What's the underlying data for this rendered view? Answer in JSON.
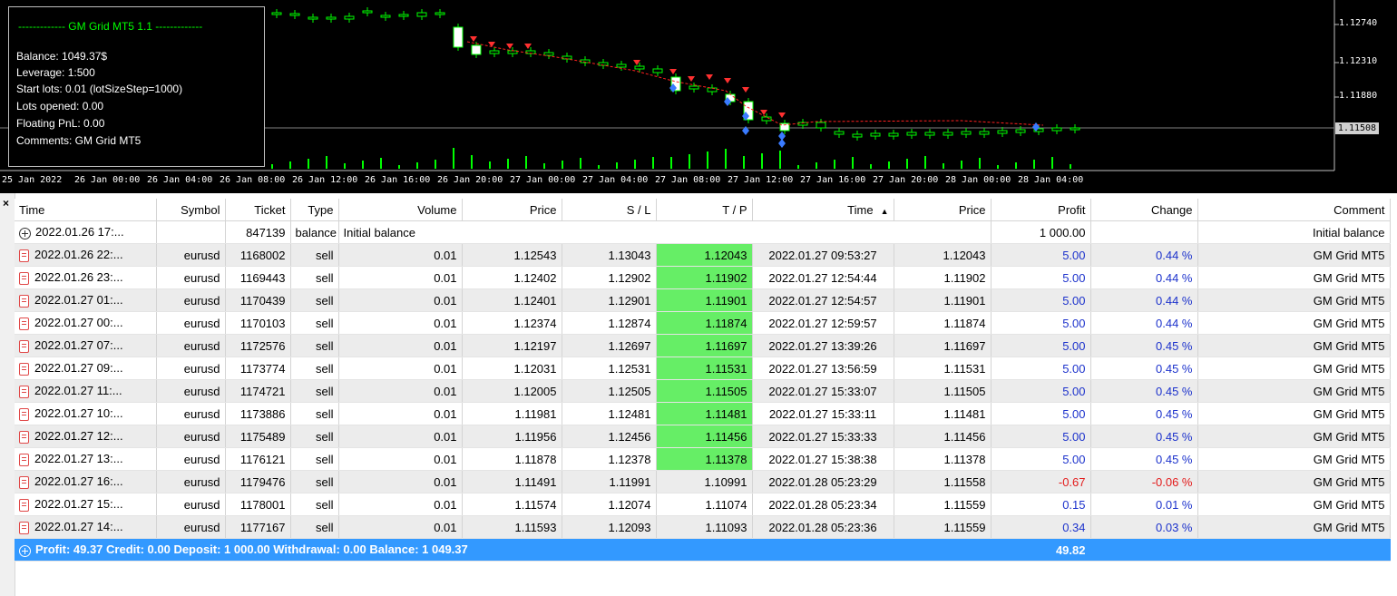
{
  "chart": {
    "price_labels": [
      "1.12740",
      "1.12310",
      "1.11880"
    ],
    "current_price": "1.11508",
    "time_labels": [
      "25 Jan 2022",
      "26 Jan 00:00",
      "26 Jan 04:00",
      "26 Jan 08:00",
      "26 Jan 12:00",
      "26 Jan 16:00",
      "26 Jan 20:00",
      "27 Jan 00:00",
      "27 Jan 04:00",
      "27 Jan 08:00",
      "27 Jan 12:00",
      "27 Jan 16:00",
      "27 Jan 20:00",
      "28 Jan 00:00",
      "28 Jan 04:00"
    ],
    "info": {
      "title": "------------- GM Grid MT5 1.1 -------------",
      "lines": [
        "Balance:  1049.37$",
        "Leverage:   1:500",
        "Start lots:     0.01 (lotSizeStep=1000)",
        "Lots opened:   0.00",
        "Floating PnL:   0.00",
        "Comments:  GM Grid MT5"
      ]
    },
    "colors": {
      "bull": "#00ff00",
      "grid": "#808080",
      "arrow_sell": "#ff3030",
      "arrow_buy": "#3a7bff",
      "trend": "#ff2020"
    }
  },
  "close_symbol": "×",
  "table": {
    "headers": [
      "Time",
      "Symbol",
      "Ticket",
      "Type",
      "Volume",
      "Price",
      "S / L",
      "T / P",
      "Time",
      "Price",
      "Profit",
      "Change",
      "Comment"
    ],
    "sort_indicator": "▲",
    "balance_row": {
      "time": "2022.01.26 17:...",
      "ticket": "847139",
      "type": "balance",
      "volume": "Initial balance",
      "profit": "1 000.00",
      "comment": "Initial balance"
    },
    "rows": [
      {
        "time": "2022.01.26 22:...",
        "symbol": "eurusd",
        "ticket": "1168002",
        "type": "sell",
        "volume": "0.01",
        "price": "1.12543",
        "sl": "1.13043",
        "tp": "1.12043",
        "tp_hit": true,
        "ctime": "2022.01.27 09:53:27",
        "cprice": "1.12043",
        "profit": "5.00",
        "change": "0.44 %",
        "neg": false,
        "comment": "GM Grid MT5"
      },
      {
        "time": "2022.01.26 23:...",
        "symbol": "eurusd",
        "ticket": "1169443",
        "type": "sell",
        "volume": "0.01",
        "price": "1.12402",
        "sl": "1.12902",
        "tp": "1.11902",
        "tp_hit": true,
        "ctime": "2022.01.27 12:54:44",
        "cprice": "1.11902",
        "profit": "5.00",
        "change": "0.44 %",
        "neg": false,
        "comment": "GM Grid MT5"
      },
      {
        "time": "2022.01.27 01:...",
        "symbol": "eurusd",
        "ticket": "1170439",
        "type": "sell",
        "volume": "0.01",
        "price": "1.12401",
        "sl": "1.12901",
        "tp": "1.11901",
        "tp_hit": true,
        "ctime": "2022.01.27 12:54:57",
        "cprice": "1.11901",
        "profit": "5.00",
        "change": "0.44 %",
        "neg": false,
        "comment": "GM Grid MT5"
      },
      {
        "time": "2022.01.27 00:...",
        "symbol": "eurusd",
        "ticket": "1170103",
        "type": "sell",
        "volume": "0.01",
        "price": "1.12374",
        "sl": "1.12874",
        "tp": "1.11874",
        "tp_hit": true,
        "ctime": "2022.01.27 12:59:57",
        "cprice": "1.11874",
        "profit": "5.00",
        "change": "0.44 %",
        "neg": false,
        "comment": "GM Grid MT5"
      },
      {
        "time": "2022.01.27 07:...",
        "symbol": "eurusd",
        "ticket": "1172576",
        "type": "sell",
        "volume": "0.01",
        "price": "1.12197",
        "sl": "1.12697",
        "tp": "1.11697",
        "tp_hit": true,
        "ctime": "2022.01.27 13:39:26",
        "cprice": "1.11697",
        "profit": "5.00",
        "change": "0.45 %",
        "neg": false,
        "comment": "GM Grid MT5"
      },
      {
        "time": "2022.01.27 09:...",
        "symbol": "eurusd",
        "ticket": "1173774",
        "type": "sell",
        "volume": "0.01",
        "price": "1.12031",
        "sl": "1.12531",
        "tp": "1.11531",
        "tp_hit": true,
        "ctime": "2022.01.27 13:56:59",
        "cprice": "1.11531",
        "profit": "5.00",
        "change": "0.45 %",
        "neg": false,
        "comment": "GM Grid MT5"
      },
      {
        "time": "2022.01.27 11:...",
        "symbol": "eurusd",
        "ticket": "1174721",
        "type": "sell",
        "volume": "0.01",
        "price": "1.12005",
        "sl": "1.12505",
        "tp": "1.11505",
        "tp_hit": true,
        "ctime": "2022.01.27 15:33:07",
        "cprice": "1.11505",
        "profit": "5.00",
        "change": "0.45 %",
        "neg": false,
        "comment": "GM Grid MT5"
      },
      {
        "time": "2022.01.27 10:...",
        "symbol": "eurusd",
        "ticket": "1173886",
        "type": "sell",
        "volume": "0.01",
        "price": "1.11981",
        "sl": "1.12481",
        "tp": "1.11481",
        "tp_hit": true,
        "ctime": "2022.01.27 15:33:11",
        "cprice": "1.11481",
        "profit": "5.00",
        "change": "0.45 %",
        "neg": false,
        "comment": "GM Grid MT5"
      },
      {
        "time": "2022.01.27 12:...",
        "symbol": "eurusd",
        "ticket": "1175489",
        "type": "sell",
        "volume": "0.01",
        "price": "1.11956",
        "sl": "1.12456",
        "tp": "1.11456",
        "tp_hit": true,
        "ctime": "2022.01.27 15:33:33",
        "cprice": "1.11456",
        "profit": "5.00",
        "change": "0.45 %",
        "neg": false,
        "comment": "GM Grid MT5"
      },
      {
        "time": "2022.01.27 13:...",
        "symbol": "eurusd",
        "ticket": "1176121",
        "type": "sell",
        "volume": "0.01",
        "price": "1.11878",
        "sl": "1.12378",
        "tp": "1.11378",
        "tp_hit": true,
        "ctime": "2022.01.27 15:38:38",
        "cprice": "1.11378",
        "profit": "5.00",
        "change": "0.45 %",
        "neg": false,
        "comment": "GM Grid MT5"
      },
      {
        "time": "2022.01.27 16:...",
        "symbol": "eurusd",
        "ticket": "1179476",
        "type": "sell",
        "volume": "0.01",
        "price": "1.11491",
        "sl": "1.11991",
        "tp": "1.10991",
        "tp_hit": false,
        "ctime": "2022.01.28 05:23:29",
        "cprice": "1.11558",
        "profit": "-0.67",
        "change": "-0.06 %",
        "neg": true,
        "comment": "GM Grid MT5"
      },
      {
        "time": "2022.01.27 15:...",
        "symbol": "eurusd",
        "ticket": "1178001",
        "type": "sell",
        "volume": "0.01",
        "price": "1.11574",
        "sl": "1.12074",
        "tp": "1.11074",
        "tp_hit": false,
        "ctime": "2022.01.28 05:23:34",
        "cprice": "1.11559",
        "profit": "0.15",
        "change": "0.01 %",
        "neg": false,
        "comment": "GM Grid MT5"
      },
      {
        "time": "2022.01.27 14:...",
        "symbol": "eurusd",
        "ticket": "1177167",
        "type": "sell",
        "volume": "0.01",
        "price": "1.11593",
        "sl": "1.12093",
        "tp": "1.11093",
        "tp_hit": false,
        "ctime": "2022.01.28 05:23:36",
        "cprice": "1.11559",
        "profit": "0.34",
        "change": "0.03 %",
        "neg": false,
        "comment": "GM Grid MT5"
      }
    ],
    "summary": {
      "text": "Profit: 49.37  Credit: 0.00  Deposit: 1 000.00  Withdrawal: 0.00  Balance: 1 049.37",
      "profit": "49.82"
    }
  }
}
